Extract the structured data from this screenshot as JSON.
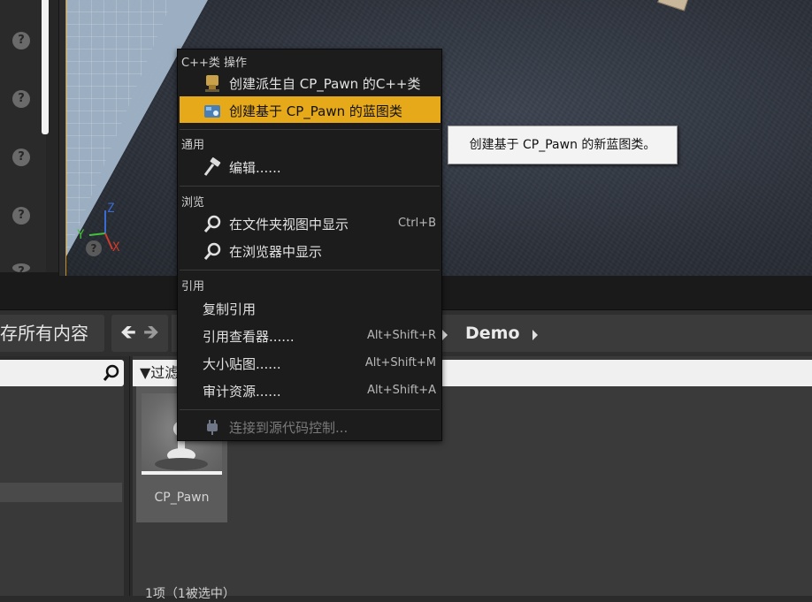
{
  "viewport": {
    "axis_z": "Z",
    "axis_y": "Y",
    "axis_x": "X"
  },
  "content_browser": {
    "save_all_label": "存所有内容",
    "nav_back": "🡸",
    "nav_forward": "🡺",
    "path_current": "Demo",
    "filter_label": "▼过滤",
    "asset_name": "CP_Pawn",
    "status": "1项（1被选中）"
  },
  "details_panel": {
    "help_glyph": "?"
  },
  "context_menu": {
    "sections": [
      {
        "header": "C++类 操作",
        "items": [
          {
            "label": "创建派生自 CP_Pawn 的C++类",
            "shortcut": "",
            "icon": "cpp-class-icon"
          },
          {
            "label": "创建基于 CP_Pawn 的蓝图类",
            "shortcut": "",
            "icon": "blueprint-icon",
            "highlighted": true
          }
        ]
      },
      {
        "header": "通用",
        "items": [
          {
            "label": "编辑......",
            "shortcut": "",
            "icon": "hammer-icon"
          }
        ]
      },
      {
        "header": "浏览",
        "items": [
          {
            "label": "在文件夹视图中显示",
            "shortcut": "Ctrl+B",
            "icon": "magnifier-icon"
          },
          {
            "label": "在浏览器中显示",
            "shortcut": "",
            "icon": "magnifier-icon"
          }
        ]
      },
      {
        "header": "引用",
        "items": [
          {
            "label": "复制引用",
            "shortcut": ""
          },
          {
            "label": "引用查看器......",
            "shortcut": "Alt+Shift+R"
          },
          {
            "label": "大小贴图......",
            "shortcut": "Alt+Shift+M"
          },
          {
            "label": "审计资源......",
            "shortcut": "Alt+Shift+A"
          }
        ]
      },
      {
        "header": "",
        "items": [
          {
            "label": "连接到源代码控制...",
            "shortcut": "",
            "icon": "plug-icon",
            "disabled": true
          }
        ]
      }
    ]
  },
  "tooltip": {
    "text": "创建基于 CP_Pawn 的新蓝图类。"
  },
  "colors": {
    "highlight": "#e6a91a",
    "viewport_border": "#c98e1e",
    "axis_x": "#d23a2a",
    "axis_y": "#44c23a",
    "axis_z": "#3a6ad2"
  }
}
